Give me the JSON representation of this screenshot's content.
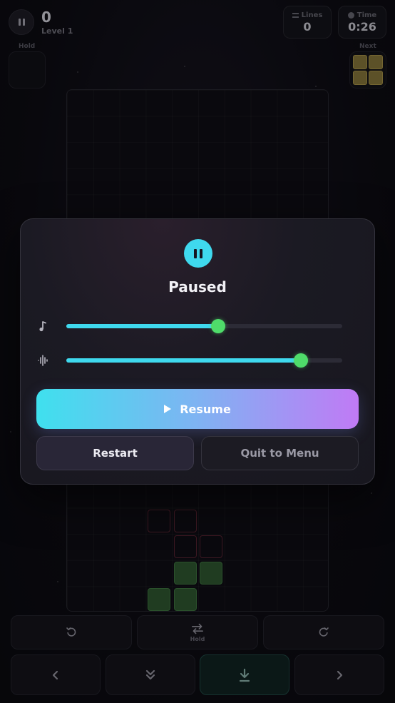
{
  "hud": {
    "score": "0",
    "level": "Level 1",
    "lines_label": "Lines",
    "lines_value": "0",
    "time_label": "Time",
    "time_value": "0:26",
    "hold_label": "Hold",
    "next_label": "Next"
  },
  "pause_menu": {
    "title": "Paused",
    "music_volume": 0.55,
    "sfx_volume": 0.85,
    "resume_label": "Resume",
    "restart_label": "Restart",
    "quit_label": "Quit to Menu"
  },
  "controls": {
    "hold_label": "Hold"
  },
  "colors": {
    "accent_cyan": "#3fd9ee",
    "accent_purple": "#c07af5",
    "slider_thumb": "#4fdc6a",
    "next_piece": "#8a7a3a",
    "placed_block": "#2f5a2f",
    "ghost_outline": "#5a2230"
  },
  "icons": {
    "pause": "pause-icon",
    "music": "music-note-icon",
    "sfx": "waveform-icon",
    "rotate_left": "rotate-ccw-icon",
    "hold_swap": "swap-arrows-icon",
    "rotate_right": "rotate-cw-icon",
    "move_left": "chevron-left-icon",
    "soft_drop": "double-chevron-down-icon",
    "hard_drop": "download-arrow-icon",
    "move_right": "chevron-right-icon"
  }
}
